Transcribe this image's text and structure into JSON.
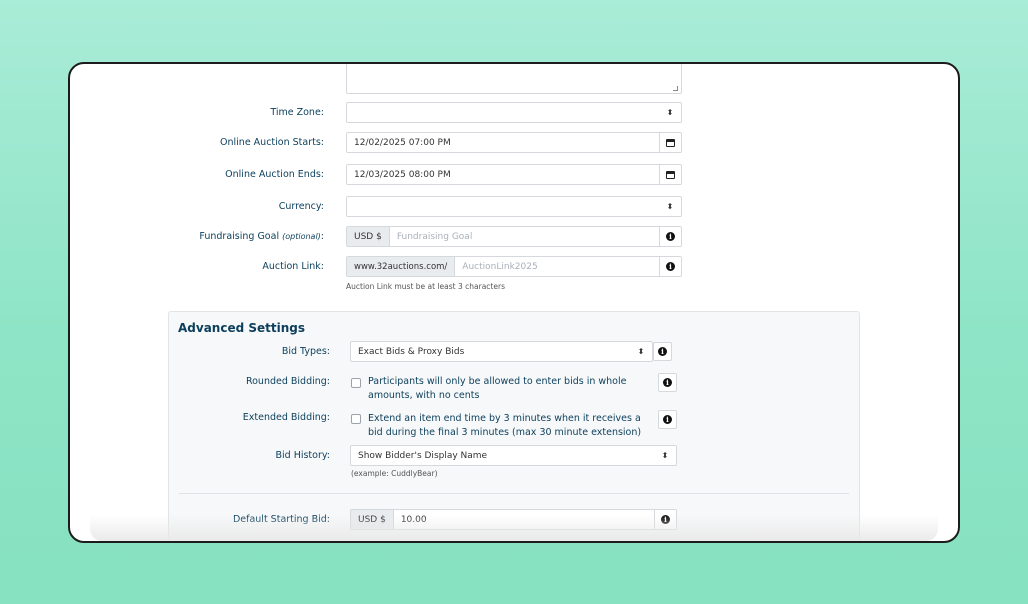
{
  "form": {
    "time_zone": {
      "label": "Time Zone:",
      "value": ""
    },
    "auction_starts": {
      "label": "Online Auction Starts:",
      "value": "12/02/2025 07:00 PM"
    },
    "auction_ends": {
      "label": "Online Auction Ends:",
      "value": "12/03/2025 08:00 PM"
    },
    "currency": {
      "label": "Currency:",
      "value": ""
    },
    "fundraising_goal": {
      "label": "Fundraising Goal",
      "optional": "(optional)",
      "colon": ":",
      "prefix": "USD $",
      "placeholder": "Fundraising Goal"
    },
    "auction_link": {
      "label": "Auction Link:",
      "prefix": "www.32auctions.com/",
      "placeholder": "AuctionLink2025",
      "help": "Auction Link must be at least 3 characters"
    }
  },
  "advanced": {
    "title": "Advanced Settings",
    "bid_types": {
      "label": "Bid Types:",
      "value": "Exact Bids & Proxy Bids"
    },
    "rounded_bidding": {
      "label": "Rounded Bidding:",
      "text": "Participants will only be allowed to enter bids in whole amounts, with no cents",
      "checked": false
    },
    "extended_bidding": {
      "label": "Extended Bidding:",
      "text": "Extend an item end time by 3 minutes when it receives a bid during the final 3 minutes (max 30 minute extension)",
      "checked": false
    },
    "bid_history": {
      "label": "Bid History:",
      "value": "Show Bidder's Display Name",
      "help": "(example: CuddlyBear)"
    },
    "default_starting_bid": {
      "label": "Default Starting Bid:",
      "prefix": "USD $",
      "value": "10.00"
    }
  },
  "icons": {
    "select": "up-down-arrows-icon",
    "calendar": "calendar-icon",
    "info": "info-circle-icon"
  },
  "colors": {
    "background": "#8ee4c6",
    "label": "#0b3f5c",
    "card_border": "#1c1c1c"
  }
}
